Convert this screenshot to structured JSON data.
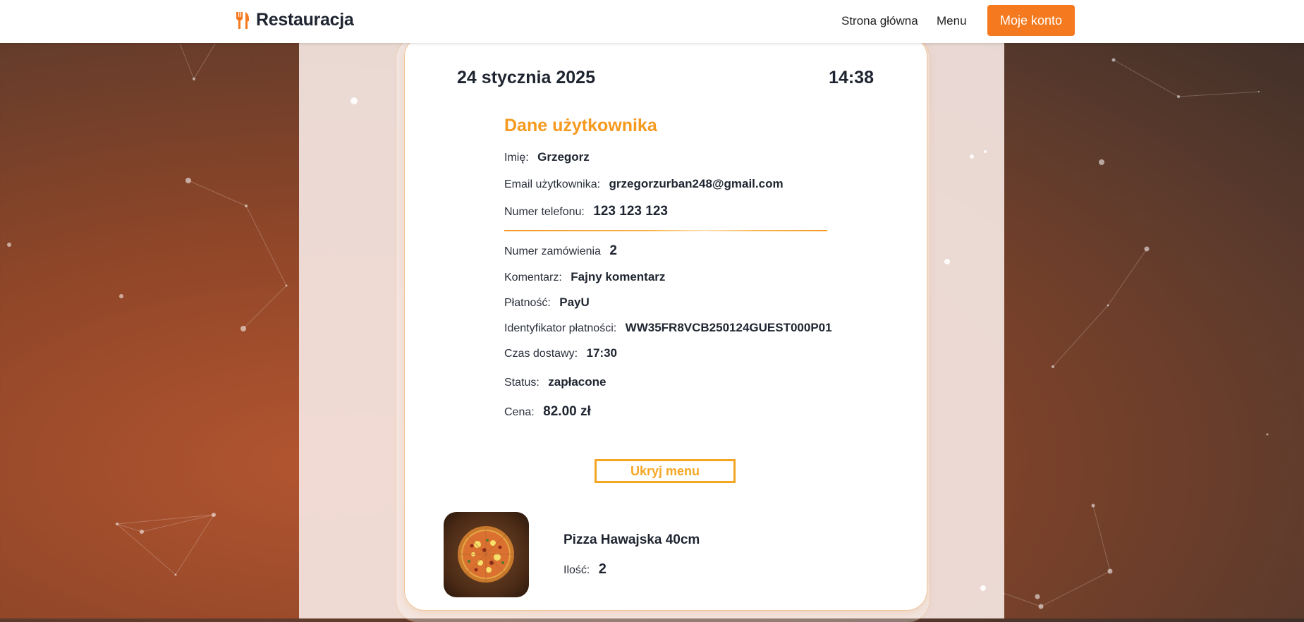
{
  "header": {
    "brand": "Restauracja",
    "brand_icon": "fork-knife-icon",
    "nav_home": "Strona główna",
    "nav_menu": "Menu",
    "account_button": "Moje konto",
    "accent_color": "#f57a1f"
  },
  "order": {
    "date": "24 stycznia 2025",
    "time": "14:38",
    "section_title": "Dane użytkownika",
    "user": {
      "name_label": "Imię:",
      "name_value": "Grzegorz",
      "email_label": "Email użytkownika:",
      "email_value": "grzegorzurban248@gmail.com",
      "phone_label": "Numer telefonu:",
      "phone_value": "123 123 123"
    },
    "details": {
      "order_no_label": "Numer zamówienia",
      "order_no_value": "2",
      "comment_label": "Komentarz:",
      "comment_value": "Fajny komentarz",
      "payment_label": "Płatność:",
      "payment_value": "PayU",
      "payment_id_label": "Identyfikator płatności:",
      "payment_id_value": "WW35FR8VCB250124GUEST000P01",
      "delivery_label": "Czas dostawy:",
      "delivery_value": "17:30",
      "status_label": "Status:",
      "status_value": "zapłacone",
      "price_label": "Cena:",
      "price_value": "82.00 zł"
    },
    "toggle_menu_button": "Ukryj menu",
    "items": [
      {
        "name": "Pizza Hawajska 40cm",
        "qty_label": "Ilość:",
        "qty_value": "2",
        "image_icon": "pizza-image"
      }
    ]
  }
}
